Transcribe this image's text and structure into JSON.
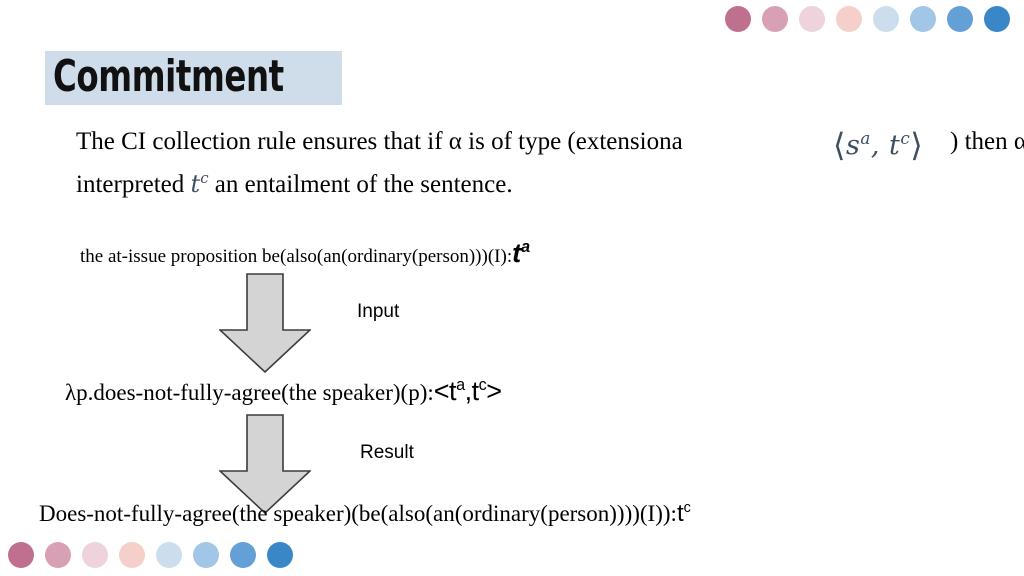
{
  "slide": {
    "title": "Commitment",
    "title_highlight_color": "#cfdcea",
    "background_color": "#ffffff"
  },
  "decor": {
    "dot_colors": [
      "#c0708f",
      "#d8a0b4",
      "#eed3dc",
      "#f5cfc9",
      "#ccdded",
      "#a2c6e6",
      "#64a0d6",
      "#3a87c8"
    ],
    "top_dot_count": 8,
    "bottom_dot_count": 8
  },
  "paragraph": {
    "line1_a": "The CI collection rule ensures that if α is of type (extensiona",
    "line1_math": {
      "open": "⟨",
      "term1_base": "s",
      "term1_sup": "a",
      "sep": ",",
      "term2_base": "t",
      "term2_sup": "c",
      "close": "⟩",
      "color": "#3d4f63"
    },
    "line1_b": ")  then α is",
    "line2_a": "interpreted ",
    "line2_math_base": "t",
    "line2_math_sup": "c",
    "line2_b": " an entailment of the sentence."
  },
  "diagram": {
    "step1": {
      "text": "the at-issue proposition be(also(an(ordinary(person)))(I):",
      "type_base": "t",
      "type_sup": "a"
    },
    "arrow1_label": "Input",
    "step2": {
      "text": "λp.does-not-fully-agree(the speaker)(p):",
      "type": "<tᵃ,tᶜ>",
      "type_open": "<",
      "type_base1": "t",
      "type_sup1": "a",
      "type_sep": ",",
      "type_base2": "t",
      "type_sup2": "c",
      "type_close": ">"
    },
    "arrow2_label": "Result",
    "step3": {
      "text": "Does-not-fully-agree(the speaker)(be(also(an(ordinary(person))))(I)):",
      "type_base": "t",
      "type_sup": "c"
    },
    "arrow_fill": "#d4d4d4",
    "arrow_stroke": "#3c3c3c"
  }
}
